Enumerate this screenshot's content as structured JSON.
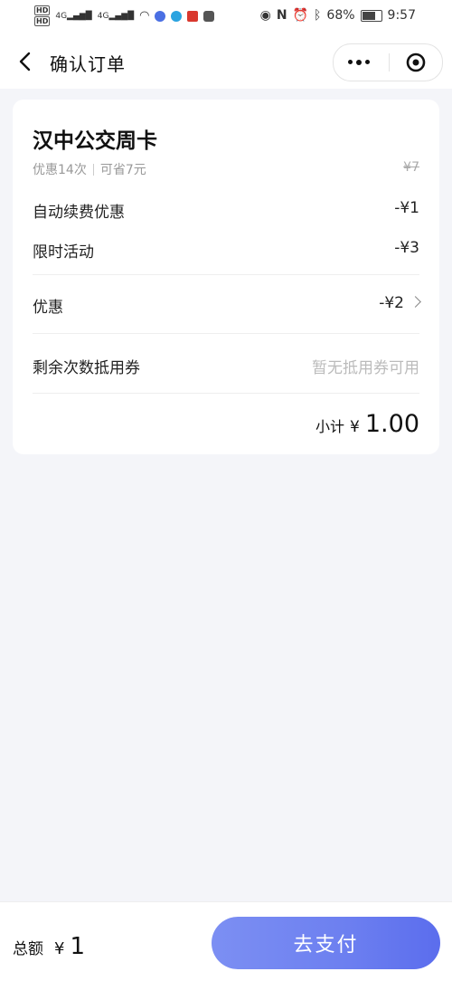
{
  "status_bar": {
    "hd1": "HD",
    "hd2": "HD",
    "signal1": "4G",
    "signal2": "4G",
    "battery": "68%",
    "time": "9:57"
  },
  "nav": {
    "title": "确认订单"
  },
  "order": {
    "product_title": "汉中公交周卡",
    "subtitle_left": "优惠14次",
    "subtitle_right": "可省7元",
    "original_price": "¥7",
    "rows": [
      {
        "label": "自动续费优惠",
        "value": "-¥1"
      },
      {
        "label": "限时活动",
        "value": "-¥3"
      },
      {
        "label": "优惠",
        "value": "-¥2"
      },
      {
        "label": "剩余次数抵用券",
        "value": "暂无抵用券可用"
      }
    ],
    "subtotal_label": "小计",
    "subtotal_currency": "¥",
    "subtotal_amount": "1.00"
  },
  "footer": {
    "total_label": "总额",
    "total_currency": "¥",
    "total_amount": "1",
    "pay_button": "去支付"
  },
  "colors": {
    "accent": "#6c7ff0",
    "background": "#f4f5f9"
  }
}
